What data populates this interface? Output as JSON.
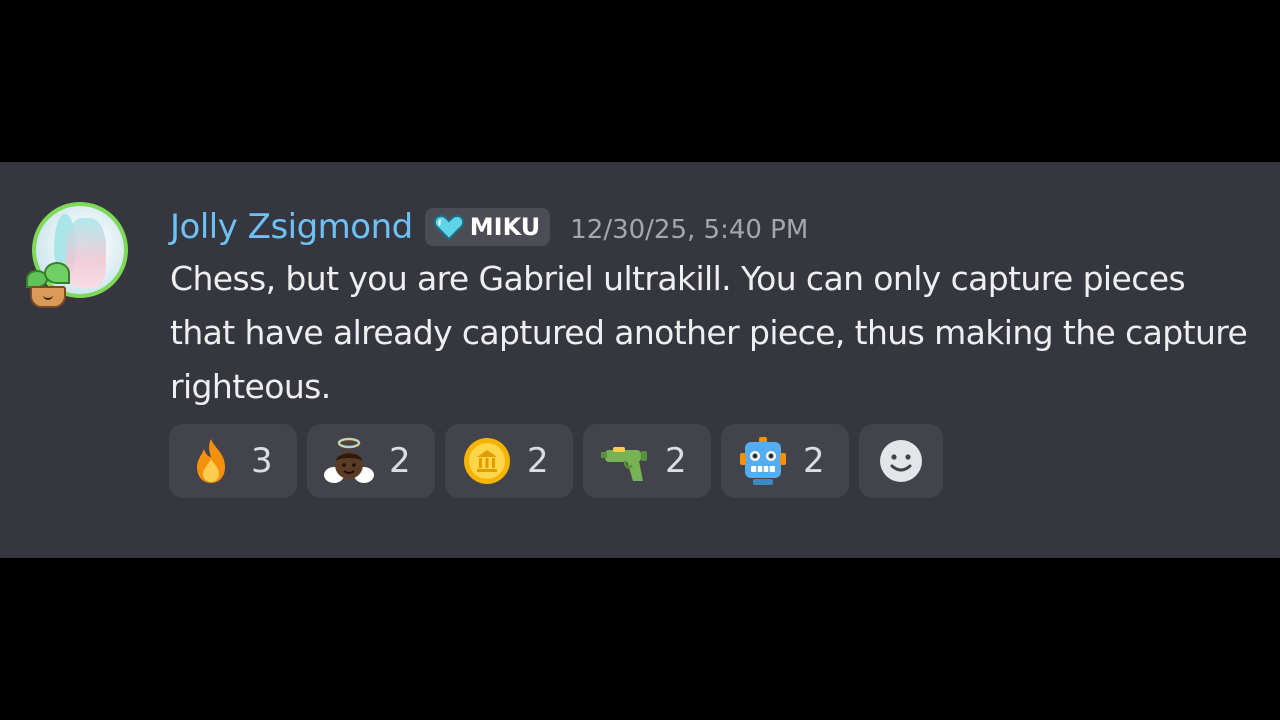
{
  "message": {
    "author": "Jolly Zsigmond",
    "tag": "MIKU",
    "tag_icon": "heart-icon",
    "timestamp": "12/30/25, 5:40 PM",
    "text": "Chess, but you are Gabriel ultrakill. You can only capture pieces that have already captured another piece, thus making the capture righteous."
  },
  "reactions": [
    {
      "emoji": "fire",
      "count": "3"
    },
    {
      "emoji": "angel",
      "count": "2"
    },
    {
      "emoji": "coin",
      "count": "2"
    },
    {
      "emoji": "water-pistol",
      "count": "2"
    },
    {
      "emoji": "robot",
      "count": "2"
    }
  ],
  "add_reaction_icon": "smiley-icon",
  "colors": {
    "background": "#36363e",
    "letterbox": "#000000",
    "username": "#6ec1f5",
    "timestamp": "#a5a7ae",
    "reaction_bg": "#42434b"
  }
}
